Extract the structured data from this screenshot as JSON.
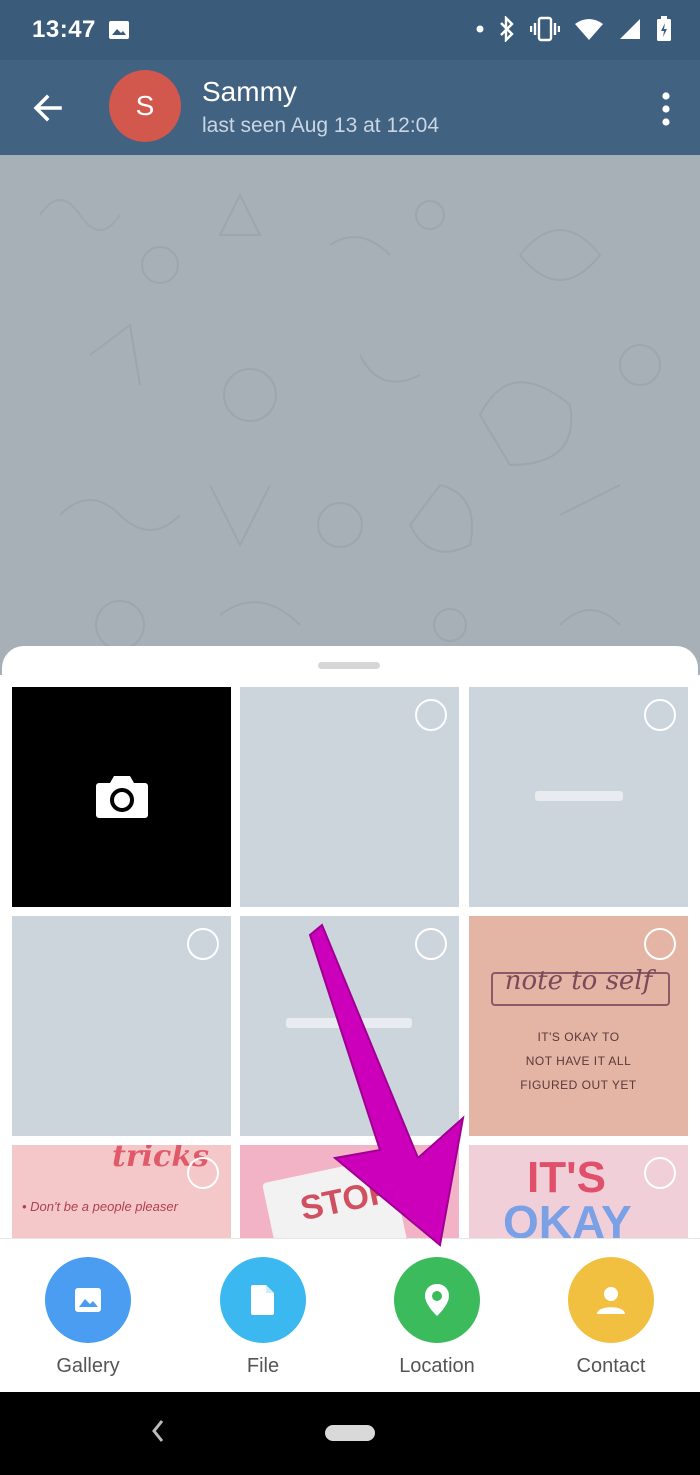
{
  "status_bar": {
    "time": "13:47"
  },
  "header": {
    "contact_name": "Sammy",
    "avatar_letter": "S",
    "last_seen": "last seen Aug 13 at 12:04"
  },
  "gallery": {
    "note_card": {
      "title": "note to self",
      "line1": "IT'S OKAY TO",
      "line2": "NOT HAVE IT ALL",
      "line3": "FIGURED OUT YET"
    },
    "tricks_card": {
      "title": "tricks",
      "line": "• Don't be a people pleaser"
    },
    "stop_card": {
      "title": "STOP"
    },
    "okay_card": {
      "line1": "IT'S",
      "line2": "OKAY"
    }
  },
  "attach_actions": [
    {
      "label": "Gallery",
      "color": "#4a9df0",
      "icon": "image-icon"
    },
    {
      "label": "File",
      "color": "#3cb8f0",
      "icon": "file-icon"
    },
    {
      "label": "Location",
      "color": "#3cbb5c",
      "icon": "location-pin-icon"
    },
    {
      "label": "Contact",
      "color": "#f2c040",
      "icon": "person-icon"
    }
  ],
  "colors": {
    "app_bar": "#426282",
    "status_bar": "#3b5b7b",
    "avatar": "#d2574c",
    "annotation_arrow": "#cc00bb"
  }
}
